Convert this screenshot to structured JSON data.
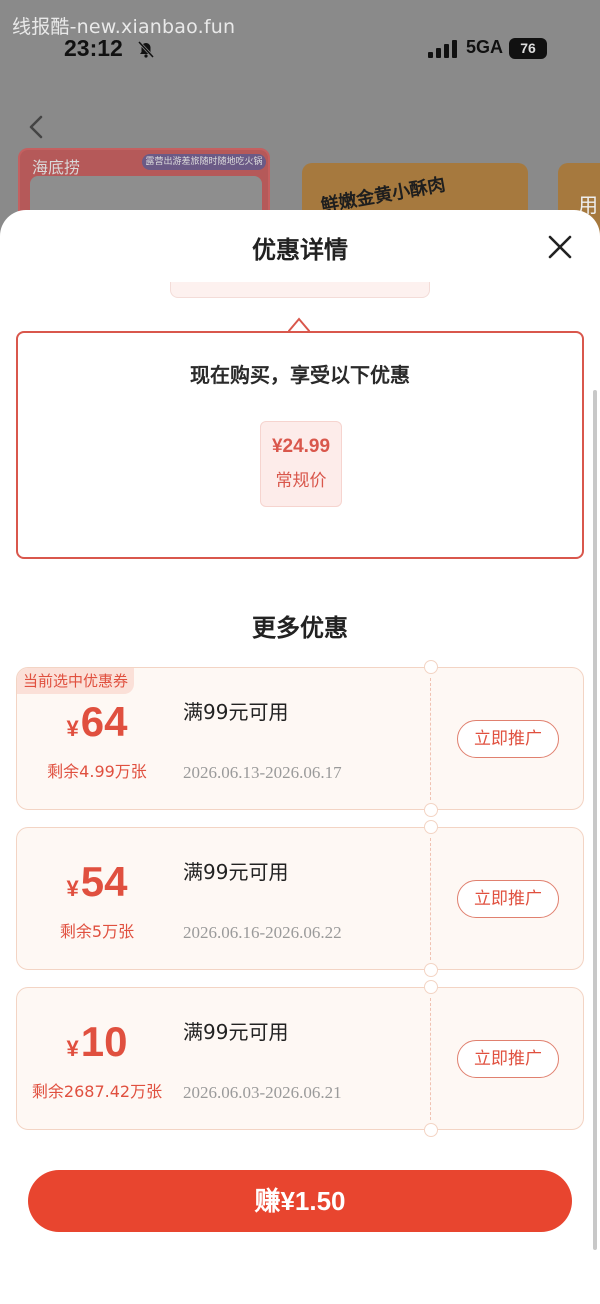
{
  "watermark": "线报酷-new.xianbao.fun",
  "status_bar": {
    "time": "23:12",
    "network": "5GA",
    "battery": "76"
  },
  "background_page": {
    "card1_brand": "海底捞",
    "card1_tag": "露营出游差旅随时随地吃火锅",
    "card2_title": "鲜嫩金黄小酥肉",
    "card3_text": "用"
  },
  "sheet": {
    "title": "优惠详情",
    "offer": {
      "heading": "现在购买，享受以下优惠",
      "price": "¥24.99",
      "price_label": "常规价"
    },
    "more_title": "更多优惠",
    "coupons": [
      {
        "selected_tag": "当前选中优惠券",
        "currency": "¥",
        "amount": "64",
        "remaining": "剩余4.99万张",
        "condition": "满99元可用",
        "dates": "2026.06.13-2026.06.17",
        "button": "立即推广"
      },
      {
        "currency": "¥",
        "amount": "54",
        "remaining": "剩余5万张",
        "condition": "满99元可用",
        "dates": "2026.06.16-2026.06.22",
        "button": "立即推广"
      },
      {
        "currency": "¥",
        "amount": "10",
        "remaining": "剩余2687.42万张",
        "condition": "满99元可用",
        "dates": "2026.06.03-2026.06.21",
        "button": "立即推广"
      }
    ],
    "earn_button": "赚¥1.50"
  },
  "icons": {
    "back": "chevron-left-icon",
    "close": "close-icon",
    "mute": "bell-off-icon",
    "signal": "signal-bars-icon"
  },
  "colors": {
    "accent": "#e8452f",
    "coupon_text": "#e0503f",
    "coupon_bg": "#fef8f4",
    "offer_border": "#d9574c"
  }
}
